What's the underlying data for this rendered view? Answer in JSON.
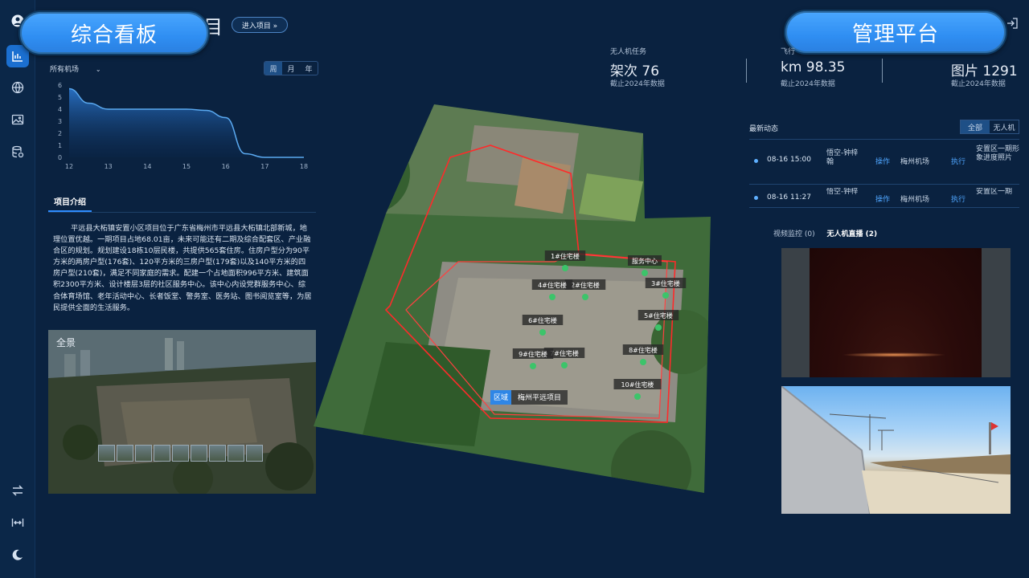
{
  "rail": {
    "icons": [
      "avatar-icon",
      "dashboard-chart-icon",
      "globe-icon",
      "image-icon",
      "database-icon",
      "switch-icon",
      "expand-width-icon",
      "moon-icon"
    ]
  },
  "header": {
    "left_pill": "综合看板",
    "right_pill": "管理平台",
    "title_tail": "目",
    "enter_button": "进入项目 »"
  },
  "chart_panel": {
    "machine_select": "所有机场",
    "ranges": [
      "周",
      "月",
      "年"
    ],
    "active_range": "周"
  },
  "chart_data": {
    "type": "area",
    "x": [
      12,
      12.5,
      13,
      14,
      15,
      15.5,
      16,
      16.5,
      17,
      18
    ],
    "values": [
      5.7,
      4.5,
      4.0,
      4.0,
      4.0,
      3.9,
      3.3,
      0.3,
      0,
      0
    ],
    "x_ticks": [
      "12",
      "13",
      "14",
      "15",
      "16",
      "17",
      "18"
    ],
    "y_ticks": [
      "0",
      "1",
      "2",
      "3",
      "4",
      "5",
      "6"
    ],
    "ylim": [
      0,
      6
    ],
    "xlim": [
      12,
      18
    ],
    "color": "#5aa9f0"
  },
  "intro": {
    "tab": "项目介绍",
    "text": "平远县大柘镇安置小区项目位于广东省梅州市平远县大柘镇北部新城，地理位置优越。一期项目占地68.01亩，未来可能还有二期及综合配套区、产业融合区的规划。规划建设18栋10层民楼，共提供565套住房。住房户型分为90平方米的两房户型(176套)、120平方米的三房户型(179套)以及140平方米的四房户型(210套)，满足不同家庭的需求。配建一个占地面积996平方米、建筑面积2300平方米、设计楼层3层的社区服务中心。该中心内设党群服务中心、综合体育场馆、老年活动中心、长者饭堂、警务室、医务站、图书阅览室等，为居民提供全面的生活服务。"
  },
  "panorama": {
    "label": "全景",
    "thumb_count": 9
  },
  "map": {
    "labels": [
      "1#住宅楼",
      "2#住宅楼",
      "3#住宅楼",
      "4#住宅楼",
      "5#住宅楼",
      "6#住宅楼",
      "7#住宅楼",
      "8#住宅楼",
      "9#住宅楼",
      "10#住宅楼",
      "服务中心"
    ],
    "region_tag": "区域",
    "project_tag": "梅州平远项目"
  },
  "stats": [
    {
      "label": "无人机任务",
      "value": "架次 76",
      "note": "截止2024年数据"
    },
    {
      "label": "飞行",
      "value": "km 98.35",
      "note": "截止2024年数据"
    },
    {
      "label": "",
      "value": "图片 1291",
      "note": "截止2024年数据"
    }
  ],
  "recent": {
    "title": "最新动态",
    "tabs": [
      "全部",
      "无人机"
    ],
    "active_tab": "全部",
    "events": [
      {
        "time": "08-16 15:00",
        "who": "悟空-钟梓翰",
        "op": "操作",
        "place": "梅州机场",
        "exec": "执行",
        "desc": "安置区一期形象进度照片"
      },
      {
        "time": "08-16 11:27",
        "who": "悟空-钟梓",
        "op": "操作",
        "place": "梅州机场",
        "exec": "执行",
        "desc": "安置区一期"
      }
    ]
  },
  "video": {
    "tabs": [
      "视频监控 (0)",
      "无人机直播 (2)"
    ],
    "active_tab": "无人机直播 (2)"
  }
}
